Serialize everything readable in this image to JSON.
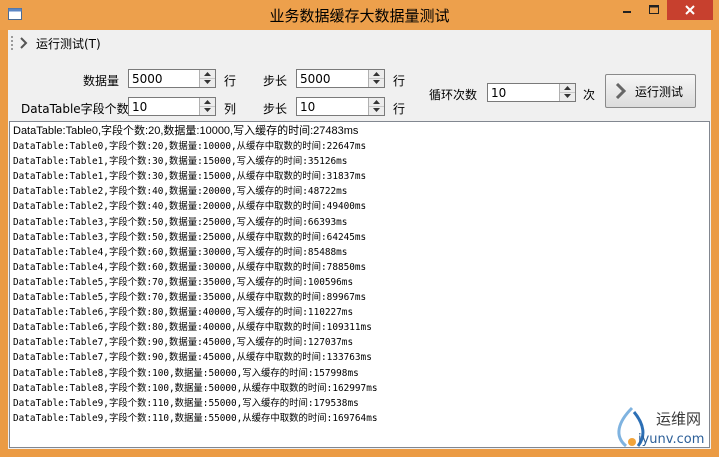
{
  "window": {
    "title": "业务数据缓存大数据量测试"
  },
  "menu": {
    "run_test": "运行测试(T)"
  },
  "form": {
    "data_count_label": "数据量",
    "data_count_value": "5000",
    "data_count_unit": "行",
    "step1_label": "步长",
    "step1_value": "5000",
    "step1_unit": "行",
    "field_count_label": "DataTable字段个数",
    "field_count_value": "10",
    "field_count_unit": "列",
    "step2_label": "步长",
    "step2_value": "10",
    "step2_unit": "行",
    "loop_label": "循环次数",
    "loop_value": "10",
    "loop_unit": "次",
    "run_button": "运行测试"
  },
  "output_lines": [
    "DataTable:Table0,字段个数:20,数据量:10000,写入缓存的时间:27483ms",
    "DataTable:Table0,字段个数:20,数据量:10000,从缓存中取数的时间:22647ms",
    "DataTable:Table1,字段个数:30,数据量:15000,写入缓存的时间:35126ms",
    "DataTable:Table1,字段个数:30,数据量:15000,从缓存中取数的时间:31837ms",
    "DataTable:Table2,字段个数:40,数据量:20000,写入缓存的时间:48722ms",
    "DataTable:Table2,字段个数:40,数据量:20000,从缓存中取数的时间:49400ms",
    "DataTable:Table3,字段个数:50,数据量:25000,写入缓存的时间:66393ms",
    "DataTable:Table3,字段个数:50,数据量:25000,从缓存中取数的时间:64245ms",
    "DataTable:Table4,字段个数:60,数据量:30000,写入缓存的时间:85488ms",
    "DataTable:Table4,字段个数:60,数据量:30000,从缓存中取数的时间:78850ms",
    "DataTable:Table5,字段个数:70,数据量:35000,写入缓存的时间:100596ms",
    "DataTable:Table5,字段个数:70,数据量:35000,从缓存中取数的时间:89967ms",
    "DataTable:Table6,字段个数:80,数据量:40000,写入缓存的时间:110227ms",
    "DataTable:Table6,字段个数:80,数据量:40000,从缓存中取数的时间:109311ms",
    "DataTable:Table7,字段个数:90,数据量:45000,写入缓存的时间:127037ms",
    "DataTable:Table7,字段个数:90,数据量:45000,从缓存中取数的时间:133763ms",
    "DataTable:Table8,字段个数:100,数据量:50000,写入缓存的时间:157998ms",
    "DataTable:Table8,字段个数:100,数据量:50000,从缓存中取数的时间:162997ms",
    "DataTable:Table9,字段个数:110,数据量:55000,写入缓存的时间:179538ms",
    "DataTable:Table9,字段个数:110,数据量:55000,从缓存中取数的时间:169764ms"
  ],
  "watermark": {
    "name": "运维网",
    "url": "iyunv.com"
  },
  "colors": {
    "frame": "#eb9b44",
    "close": "#c7402e",
    "client": "#f0f0f0"
  }
}
